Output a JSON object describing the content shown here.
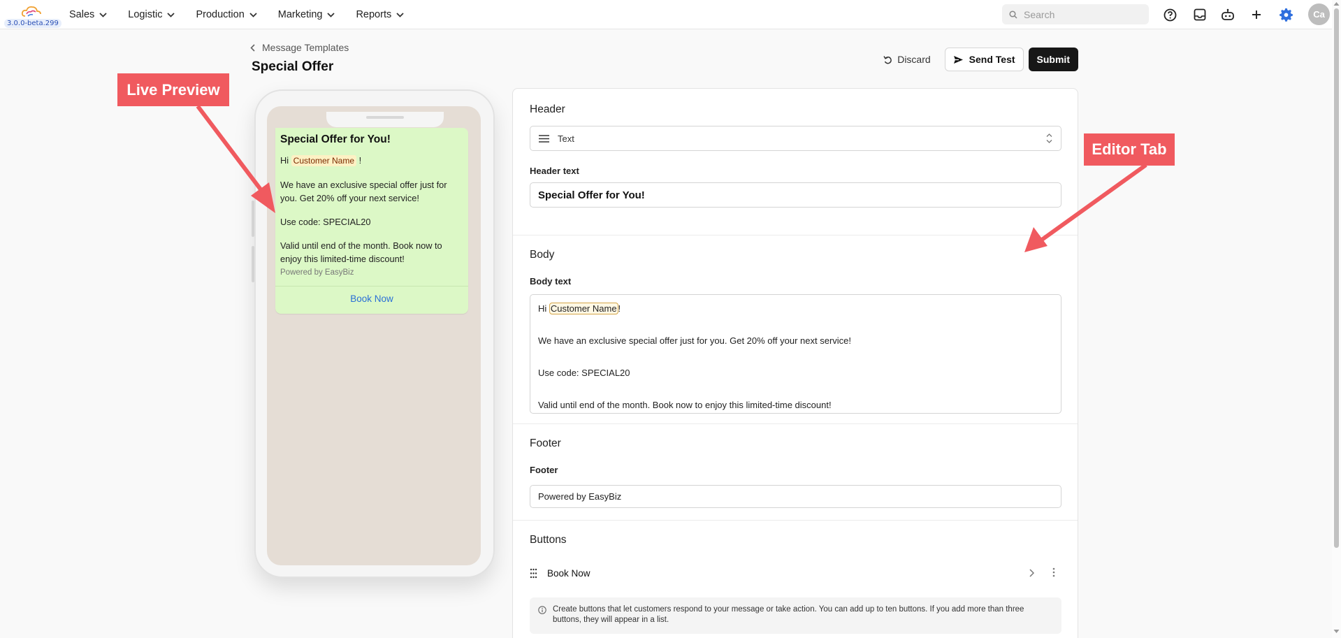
{
  "app": {
    "version": "3.0.0-beta.299"
  },
  "nav": {
    "items": [
      {
        "label": "Sales"
      },
      {
        "label": "Logistic"
      },
      {
        "label": "Production"
      },
      {
        "label": "Marketing"
      },
      {
        "label": "Reports"
      }
    ]
  },
  "search": {
    "placeholder": "Search"
  },
  "user": {
    "initials": "Ca"
  },
  "page": {
    "breadcrumb": "Message Templates",
    "title": "Special Offer"
  },
  "actions": {
    "discard": "Discard",
    "send_test": "Send Test",
    "submit": "Submit"
  },
  "preview": {
    "title": "Special Offer for You!",
    "greeting_prefix": "Hi",
    "variable": "Customer Name",
    "greeting_suffix": "!",
    "paragraph1": "We have an exclusive special offer just for you. Get 20% off your next service!",
    "paragraph2": "Use code: SPECIAL20",
    "paragraph3": "Valid until end of the month. Book now to enjoy this limited-time discount!",
    "footer": "Powered by EasyBiz",
    "button": "Book Now"
  },
  "editor": {
    "header": {
      "section_title": "Header",
      "type_value": "Text",
      "text_label": "Header text",
      "text_value": "Special Offer for You!"
    },
    "body": {
      "section_title": "Body",
      "text_label": "Body text",
      "line1_prefix": "Hi",
      "line1_variable": "Customer Name",
      "line1_suffix": "!",
      "line2": "We have an exclusive special offer just for you. Get 20% off your next service!",
      "line3": "Use code: SPECIAL20",
      "line4": "Valid until end of the month. Book now to enjoy this limited-time discount!"
    },
    "footer": {
      "section_title": "Footer",
      "label": "Footer",
      "value": "Powered by EasyBiz"
    },
    "buttons": {
      "section_title": "Buttons",
      "items": [
        {
          "label": "Book Now"
        }
      ],
      "hint": "Create buttons that let customers respond to your message or take action. You can add up to ten buttons. If you add more than three buttons, they will appear in a list."
    }
  },
  "annotations": {
    "live_preview": "Live Preview",
    "editor_tab": "Editor Tab"
  },
  "colors": {
    "annotation": "#f05a5f",
    "bubble": "#dcf8c6",
    "chat_background": "#e5ddd5",
    "link": "#2a6fd6",
    "settings_icon": "#2f6fde"
  }
}
